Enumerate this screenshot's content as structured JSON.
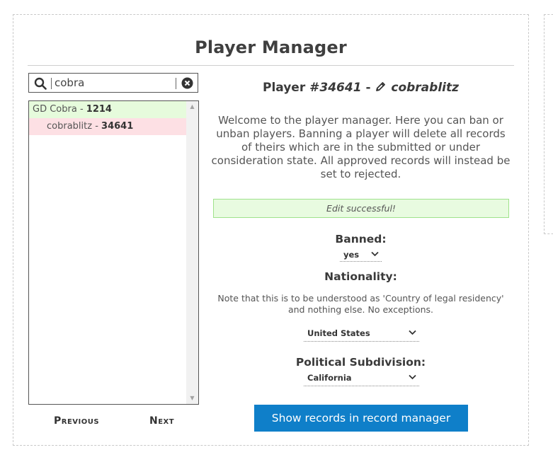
{
  "title": "Player Manager",
  "search": {
    "value": "cobra",
    "placeholder": ""
  },
  "list": {
    "items": [
      {
        "name": "GD Cobra",
        "sep": " - ",
        "id": "1214",
        "state": "parent"
      },
      {
        "name": "cobrablitz",
        "sep": " - ",
        "id": "34641",
        "state": "child"
      }
    ]
  },
  "pager": {
    "previous": "Previous",
    "next": "Next"
  },
  "player": {
    "prefix": "Player #",
    "number": "34641",
    "dash": " - ",
    "name": "cobrablitz"
  },
  "welcome_text": "Welcome to the player manager. Here you can ban or unban players. Banning a player will delete all records of theirs which are in the submitted or under consideration state. All approved records will instead be set to rejected.",
  "success_message": "Edit successful!",
  "banned": {
    "label": "Banned:",
    "value": "yes"
  },
  "nationality": {
    "label": "Nationality:",
    "note": "Note that this is to be understood as 'Country of legal residency' and nothing else. No exceptions.",
    "value": "United States"
  },
  "subdivision": {
    "label": "Political Subdivision:",
    "value": "California"
  },
  "show_records_button": "Show records in record manager",
  "colors": {
    "accent": "#0f7fc9",
    "success_bg": "#e8fbe0",
    "selected_parent_bg": "#e6fbdc",
    "selected_child_bg": "#fde0e4"
  },
  "icons": [
    "search-icon",
    "clear-icon",
    "pencil-icon",
    "chevron-down-icon"
  ]
}
